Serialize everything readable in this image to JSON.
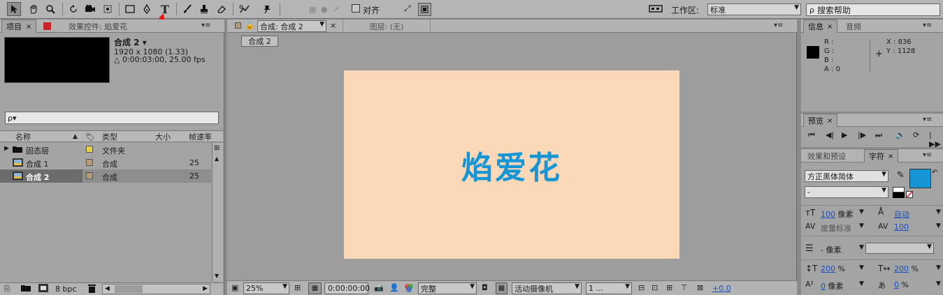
{
  "toolbar": {
    "tools": [
      "selection-tool-icon",
      "hand-tool-icon",
      "zoom-tool-icon",
      "rotate-tool-icon",
      "camera-tool-icon",
      "pan-behind-tool-icon",
      "rectangle-tool-icon",
      "pen-tool-icon",
      "type-tool-icon",
      "brush-tool-icon",
      "clone-stamp-tool-icon",
      "eraser-tool-icon",
      "roto-brush-tool-icon",
      "puppet-pin-tool-icon"
    ],
    "align_label": "对齐",
    "workspace_label": "工作区:",
    "workspace_value": "标准",
    "search_placeholder": "搜索帮助"
  },
  "project_panel": {
    "tab_project": "项目",
    "tab_effects": "效果控件: 焰爱花",
    "comp_name": "合成 2 ▾",
    "comp_size": "1920 x 1080 (1.33)",
    "comp_duration": "△ 0:00:03:00, 25.00 fps",
    "search_value": "ρ▾",
    "columns": {
      "name": "名称",
      "type": "类型",
      "size": "大小",
      "fps": "帧速率"
    },
    "items": [
      {
        "name": "固态层",
        "type": "文件夹",
        "fps": "",
        "label_color": "#e6d34a"
      },
      {
        "name": "合成 1",
        "type": "合成",
        "fps": "25",
        "label_color": "#b59a75"
      },
      {
        "name": "合成 2",
        "type": "合成",
        "fps": "25",
        "label_color": "#b59a75"
      }
    ],
    "bpc": "8 bpc"
  },
  "comp_panel": {
    "tab_comp": "合成: 合成 2",
    "tab_layer": "图层: (无)",
    "breadcrumb": "合成 2",
    "canvas_bg": "#fbd8b8",
    "canvas_text": "焰爱花",
    "canvas_text_color": "#1796d6",
    "footer": {
      "zoom": "25%",
      "timecode": "0:00:00:00",
      "resolution": "完整",
      "camera": "活动摄像机",
      "view": "1 ...",
      "exposure": "+0.0"
    }
  },
  "info_panel": {
    "tab_info": "信息",
    "tab_audio": "音频",
    "r": "R :",
    "g": "G :",
    "b": "B :",
    "a": "A : 0",
    "x": "X : 836",
    "y": "Y : 1128"
  },
  "preview_panel": {
    "tab": "预览"
  },
  "character_panel": {
    "tab_effects": "效果和预设",
    "tab_char": "字符",
    "font": "方正黑体简体",
    "style": "-",
    "fill_color": "#1796d6",
    "size_value": "100",
    "size_unit": "像素",
    "leading_value": "自动",
    "kerning_label": "度量标准",
    "tracking_value": "100",
    "stroke_unit": "- 像素",
    "vscale": "200",
    "hscale": "200",
    "baseline": "0",
    "baseline_unit": "像素",
    "tsume": "0",
    "pct": "%"
  }
}
